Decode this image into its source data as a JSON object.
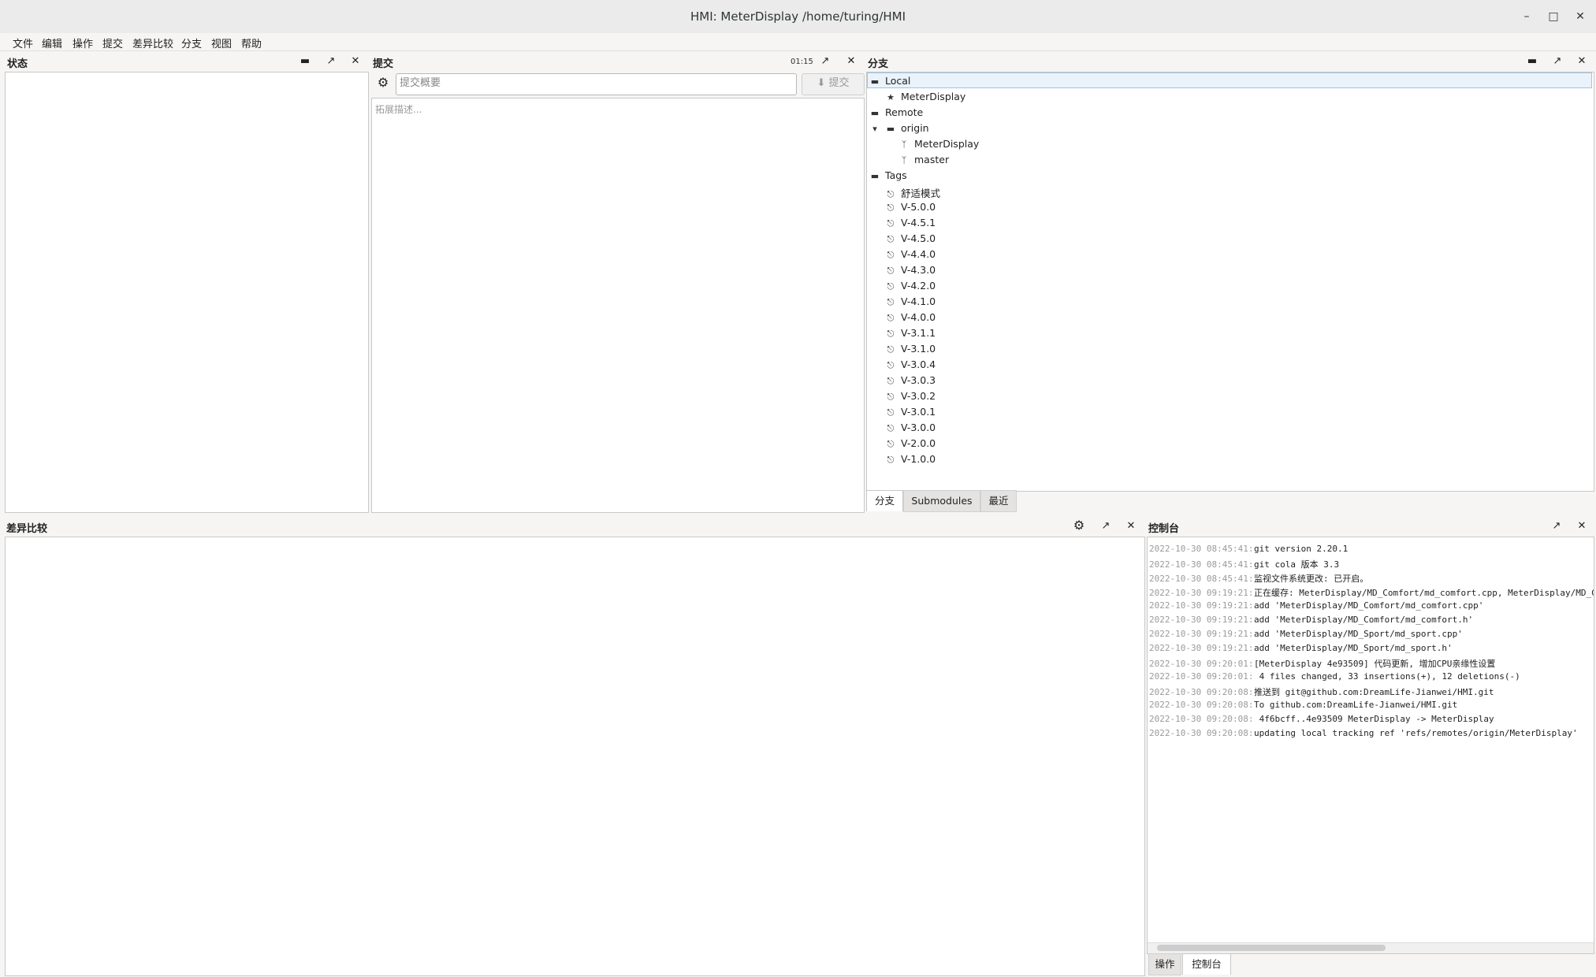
{
  "window": {
    "title": "HMI: MeterDisplay /home/turing/HMI"
  },
  "menu": [
    "文件",
    "编辑",
    "操作",
    "提交",
    "差异比较",
    "分支",
    "视图",
    "帮助"
  ],
  "status_panel": {
    "title": "状态"
  },
  "commit_panel": {
    "title": "提交",
    "time": "01:15",
    "summary_placeholder": "提交概要",
    "description_placeholder": "拓展描述...",
    "commit_label": "提交"
  },
  "branch_panel": {
    "title": "分支",
    "local_label": "Local",
    "local_branches": [
      "MeterDisplay"
    ],
    "remote_label": "Remote",
    "remote_name": "origin",
    "remote_branches": [
      "MeterDisplay",
      "master"
    ],
    "tags_label": "Tags",
    "tags": [
      "舒适模式",
      "V-5.0.0",
      "V-4.5.1",
      "V-4.5.0",
      "V-4.4.0",
      "V-4.3.0",
      "V-4.2.0",
      "V-4.1.0",
      "V-4.0.0",
      "V-3.1.1",
      "V-3.1.0",
      "V-3.0.4",
      "V-3.0.3",
      "V-3.0.2",
      "V-3.0.1",
      "V-3.0.0",
      "V-2.0.0",
      "V-1.0.0"
    ],
    "tabs": [
      "分支",
      "Submodules",
      "最近"
    ]
  },
  "diff_panel": {
    "title": "差异比较"
  },
  "console_panel": {
    "title": "控制台",
    "lines": [
      {
        "ts": "2022-10-30 08:45:41:",
        "msg": "git version 2.20.1"
      },
      {
        "ts": "2022-10-30 08:45:41:",
        "msg": "git cola 版本 3.3"
      },
      {
        "ts": "2022-10-30 08:45:41:",
        "msg": "监视文件系统更改: 已开启。"
      },
      {
        "ts": "2022-10-30 09:19:21:",
        "msg": "正在缓存: MeterDisplay/MD_Comfort/md_comfort.cpp, MeterDisplay/MD_Comfor"
      },
      {
        "ts": "2022-10-30 09:19:21:",
        "msg": "add 'MeterDisplay/MD_Comfort/md_comfort.cpp'"
      },
      {
        "ts": "2022-10-30 09:19:21:",
        "msg": "add 'MeterDisplay/MD_Comfort/md_comfort.h'"
      },
      {
        "ts": "2022-10-30 09:19:21:",
        "msg": "add 'MeterDisplay/MD_Sport/md_sport.cpp'"
      },
      {
        "ts": "2022-10-30 09:19:21:",
        "msg": "add 'MeterDisplay/MD_Sport/md_sport.h'"
      },
      {
        "ts": "2022-10-30 09:20:01:",
        "msg": "[MeterDisplay 4e93509] 代码更新, 增加CPU亲缘性设置"
      },
      {
        "ts": "2022-10-30 09:20:01:",
        "msg": " 4 files changed, 33 insertions(+), 12 deletions(-)"
      },
      {
        "ts": "2022-10-30 09:20:08:",
        "msg": "推送到 git@github.com:DreamLife-Jianwei/HMI.git"
      },
      {
        "ts": "2022-10-30 09:20:08:",
        "msg": "To github.com:DreamLife-Jianwei/HMI.git"
      },
      {
        "ts": "2022-10-30 09:20:08:",
        "msg": "   4f6bcff..4e93509  MeterDisplay -> MeterDisplay"
      },
      {
        "ts": "2022-10-30 09:20:08:",
        "msg": "updating local tracking ref 'refs/remotes/origin/MeterDisplay'"
      }
    ]
  },
  "bottom_tabs": [
    "操作",
    "控制台"
  ],
  "icons": {
    "minimize": "minimize-icon",
    "maximize": "maximize-icon",
    "close": "close-icon",
    "gear": "gear-icon",
    "float": "float-icon",
    "collapse": "collapse-icon",
    "star": "star-icon",
    "branch": "branch-icon",
    "tag": "tag-icon"
  }
}
